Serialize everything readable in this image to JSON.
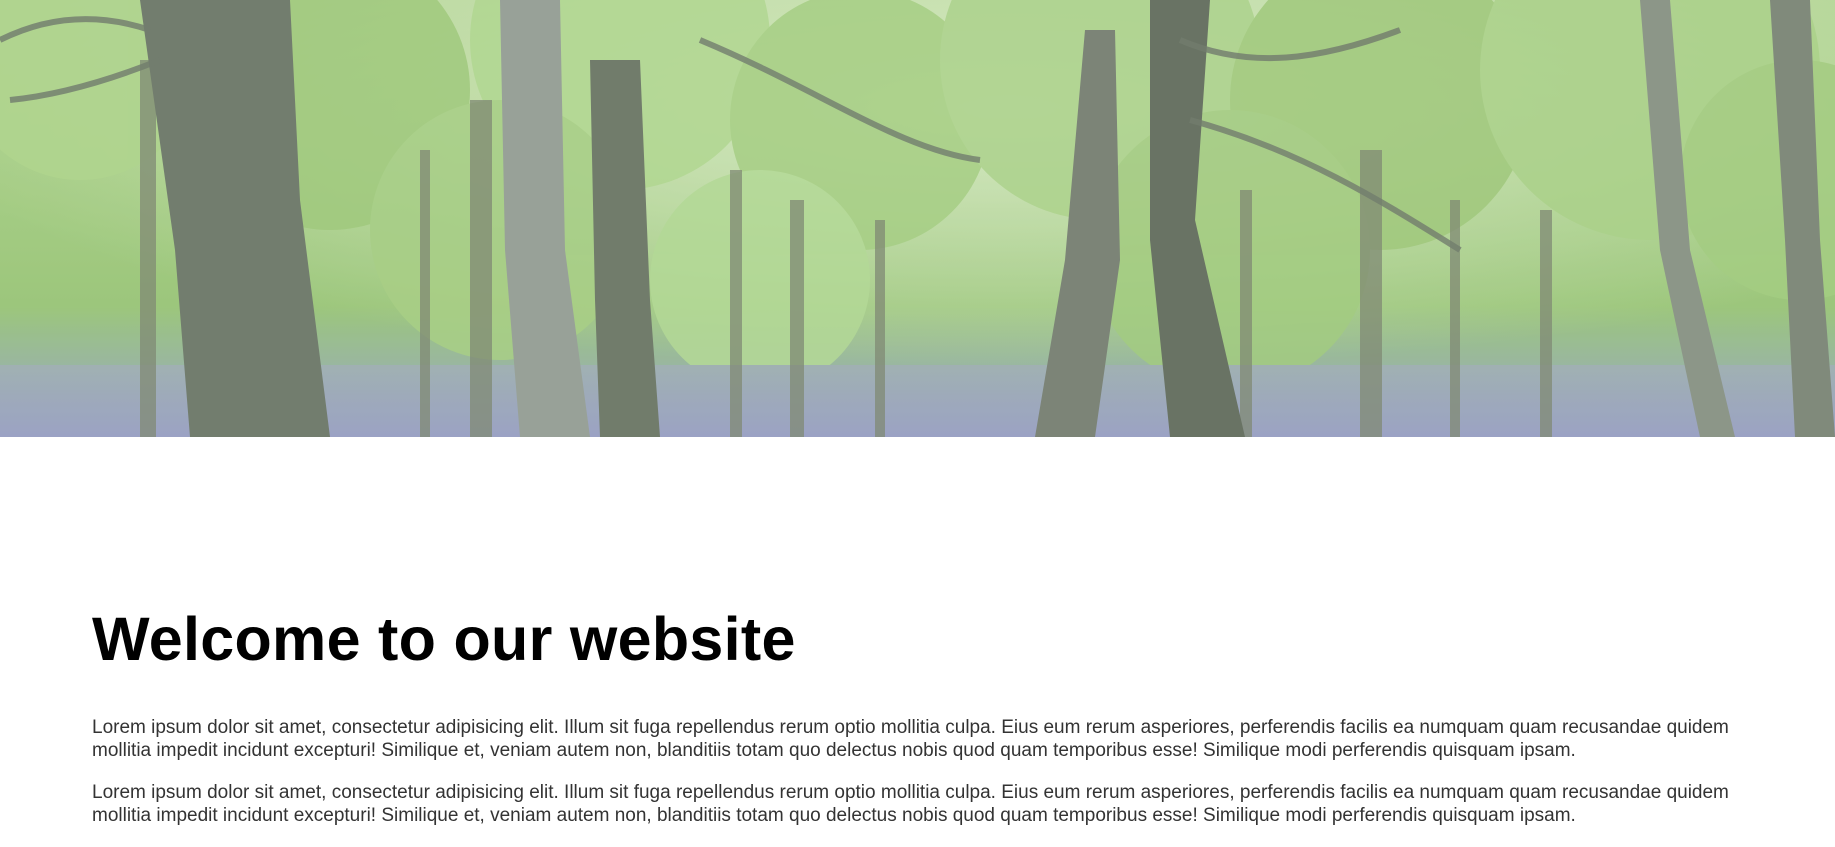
{
  "hero": {
    "image": "forest-banner",
    "colors": {
      "canopy": "#9cc877",
      "canopy_light": "#bfe09f",
      "trunk": "#6f7a6a",
      "trunk_dark": "#4d5749",
      "bluebells": "#8c97b8"
    }
  },
  "main": {
    "heading": "Welcome to our website",
    "paragraphs": [
      "Lorem ipsum dolor sit amet, consectetur adipisicing elit. Illum sit fuga repellendus rerum optio mollitia culpa. Eius eum rerum asperiores, perferendis facilis ea numquam quam recusandae quidem mollitia impedit incidunt excepturi! Similique et, veniam autem non, blanditiis totam quo delectus nobis quod quam temporibus esse! Similique modi perferendis quisquam ipsam.",
      "Lorem ipsum dolor sit amet, consectetur adipisicing elit. Illum sit fuga repellendus rerum optio mollitia culpa. Eius eum rerum asperiores, perferendis facilis ea numquam quam recusandae quidem mollitia impedit incidunt excepturi! Similique et, veniam autem non, blanditiis totam quo delectus nobis quod quam temporibus esse! Similique modi perferendis quisquam ipsam."
    ]
  }
}
